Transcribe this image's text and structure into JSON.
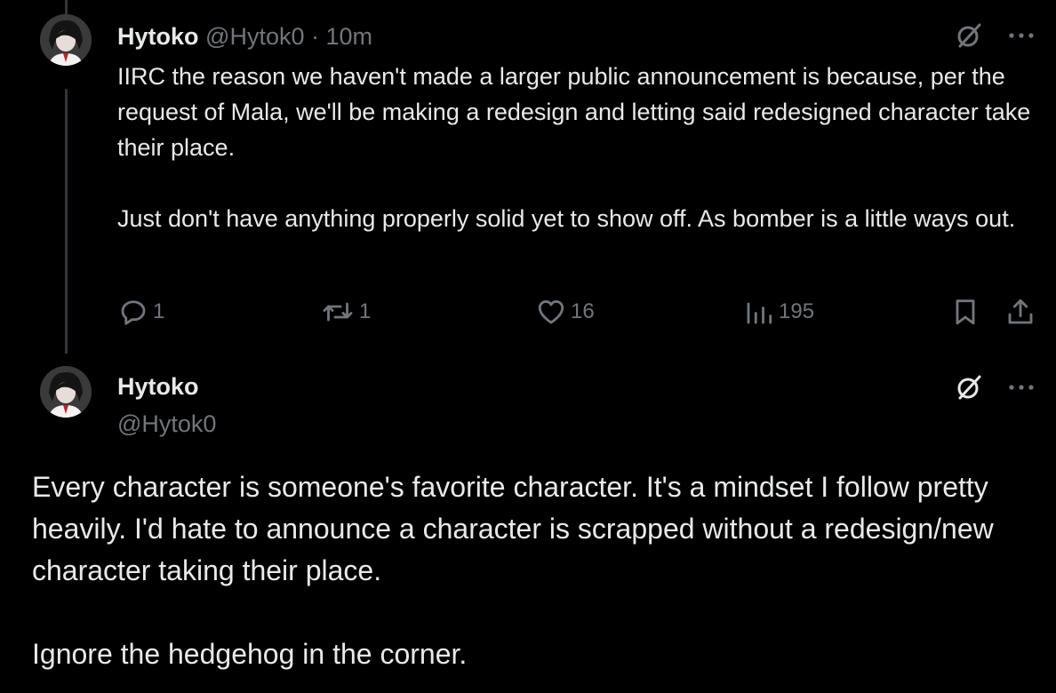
{
  "reply_tweet": {
    "display_name": "Hytoko",
    "handle": "@Hytok0",
    "separator": " · ",
    "time": "10m",
    "text": "IIRC the reason we haven't made a larger public announcement is because, per the request of Mala, we'll be making a redesign and letting said redesigned character take their place.\n\nJust don't have anything properly solid yet to show off. As bomber is a little ways out.",
    "replies": "1",
    "reposts": "1",
    "likes": "16",
    "views": "195",
    "icons": {
      "reply": "reply-icon",
      "repost": "repost-icon",
      "like": "heart-icon",
      "views": "views-icon",
      "bookmark": "bookmark-icon",
      "share": "share-icon",
      "grok": "grok-icon",
      "more": "more-icon"
    }
  },
  "main_tweet": {
    "display_name": "Hytoko",
    "handle": "@Hytok0",
    "text": "Every character is someone's favorite character. It's a mindset I follow pretty heavily. I'd hate to announce a character is scrapped without a redesign/new character taking their place.\n\nIgnore the hedgehog in the corner."
  },
  "colors": {
    "background": "#000000",
    "primary_text": "#e7e9ea",
    "secondary_text": "#71767b",
    "thread_line": "#333639"
  }
}
